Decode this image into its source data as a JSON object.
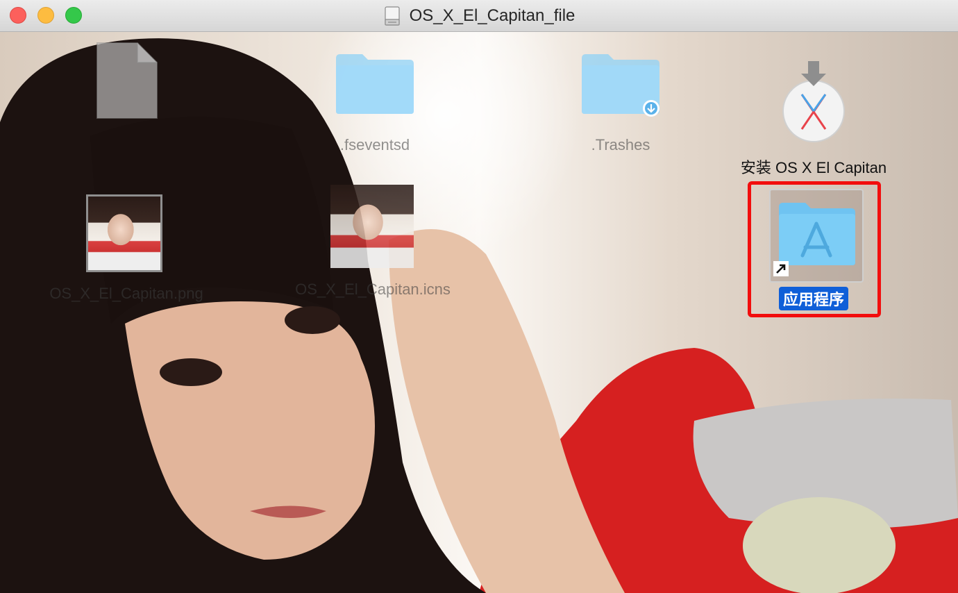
{
  "window": {
    "title": "OS_X_El_Capitan_file"
  },
  "items": {
    "hidden_file_1": "",
    "fseventsd": ".fseventsd",
    "trashes": ".Trashes",
    "installer": "安装 OS X El Capitan",
    "png_file": "OS_X_El_Capitan.png",
    "icns_file": "OS_X_El_Capitan.icns",
    "applications_alias": "应用程序"
  },
  "colors": {
    "folder_blue": "#8fd1f5",
    "selection_blue": "#0f5fd8",
    "highlight_red": "#f20d0d"
  },
  "icons": {
    "file": "generic-file-icon",
    "folder": "folder-icon",
    "installer": "os-x-installer-icon",
    "applications": "applications-folder-icon",
    "alias": "alias-arrow-icon"
  }
}
